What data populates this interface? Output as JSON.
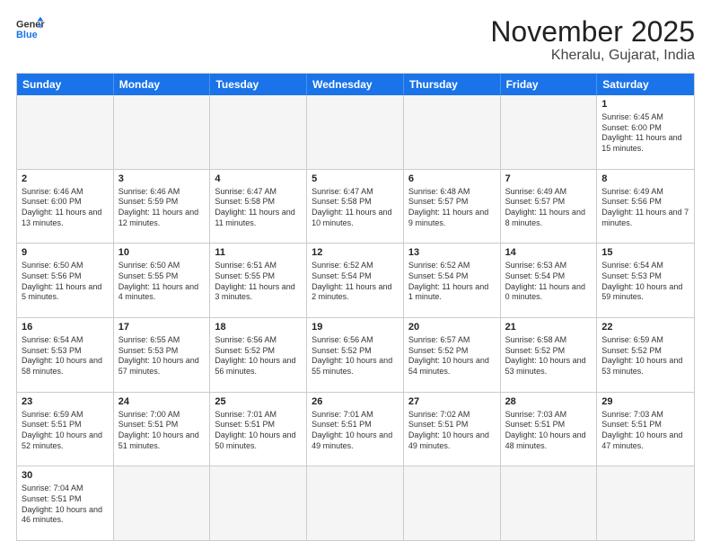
{
  "header": {
    "logo_general": "General",
    "logo_blue": "Blue",
    "title": "November 2025",
    "subtitle": "Kheralu, Gujarat, India"
  },
  "days_of_week": [
    "Sunday",
    "Monday",
    "Tuesday",
    "Wednesday",
    "Thursday",
    "Friday",
    "Saturday"
  ],
  "weeks": [
    [
      {
        "day": "",
        "info": ""
      },
      {
        "day": "",
        "info": ""
      },
      {
        "day": "",
        "info": ""
      },
      {
        "day": "",
        "info": ""
      },
      {
        "day": "",
        "info": ""
      },
      {
        "day": "",
        "info": ""
      },
      {
        "day": "1",
        "info": "Sunrise: 6:45 AM\nSunset: 6:00 PM\nDaylight: 11 hours\nand 15 minutes."
      }
    ],
    [
      {
        "day": "2",
        "info": "Sunrise: 6:46 AM\nSunset: 6:00 PM\nDaylight: 11 hours\nand 13 minutes."
      },
      {
        "day": "3",
        "info": "Sunrise: 6:46 AM\nSunset: 5:59 PM\nDaylight: 11 hours\nand 12 minutes."
      },
      {
        "day": "4",
        "info": "Sunrise: 6:47 AM\nSunset: 5:58 PM\nDaylight: 11 hours\nand 11 minutes."
      },
      {
        "day": "5",
        "info": "Sunrise: 6:47 AM\nSunset: 5:58 PM\nDaylight: 11 hours\nand 10 minutes."
      },
      {
        "day": "6",
        "info": "Sunrise: 6:48 AM\nSunset: 5:57 PM\nDaylight: 11 hours\nand 9 minutes."
      },
      {
        "day": "7",
        "info": "Sunrise: 6:49 AM\nSunset: 5:57 PM\nDaylight: 11 hours\nand 8 minutes."
      },
      {
        "day": "8",
        "info": "Sunrise: 6:49 AM\nSunset: 5:56 PM\nDaylight: 11 hours\nand 7 minutes."
      }
    ],
    [
      {
        "day": "9",
        "info": "Sunrise: 6:50 AM\nSunset: 5:56 PM\nDaylight: 11 hours\nand 5 minutes."
      },
      {
        "day": "10",
        "info": "Sunrise: 6:50 AM\nSunset: 5:55 PM\nDaylight: 11 hours\nand 4 minutes."
      },
      {
        "day": "11",
        "info": "Sunrise: 6:51 AM\nSunset: 5:55 PM\nDaylight: 11 hours\nand 3 minutes."
      },
      {
        "day": "12",
        "info": "Sunrise: 6:52 AM\nSunset: 5:54 PM\nDaylight: 11 hours\nand 2 minutes."
      },
      {
        "day": "13",
        "info": "Sunrise: 6:52 AM\nSunset: 5:54 PM\nDaylight: 11 hours\nand 1 minute."
      },
      {
        "day": "14",
        "info": "Sunrise: 6:53 AM\nSunset: 5:54 PM\nDaylight: 11 hours\nand 0 minutes."
      },
      {
        "day": "15",
        "info": "Sunrise: 6:54 AM\nSunset: 5:53 PM\nDaylight: 10 hours\nand 59 minutes."
      }
    ],
    [
      {
        "day": "16",
        "info": "Sunrise: 6:54 AM\nSunset: 5:53 PM\nDaylight: 10 hours\nand 58 minutes."
      },
      {
        "day": "17",
        "info": "Sunrise: 6:55 AM\nSunset: 5:53 PM\nDaylight: 10 hours\nand 57 minutes."
      },
      {
        "day": "18",
        "info": "Sunrise: 6:56 AM\nSunset: 5:52 PM\nDaylight: 10 hours\nand 56 minutes."
      },
      {
        "day": "19",
        "info": "Sunrise: 6:56 AM\nSunset: 5:52 PM\nDaylight: 10 hours\nand 55 minutes."
      },
      {
        "day": "20",
        "info": "Sunrise: 6:57 AM\nSunset: 5:52 PM\nDaylight: 10 hours\nand 54 minutes."
      },
      {
        "day": "21",
        "info": "Sunrise: 6:58 AM\nSunset: 5:52 PM\nDaylight: 10 hours\nand 53 minutes."
      },
      {
        "day": "22",
        "info": "Sunrise: 6:59 AM\nSunset: 5:52 PM\nDaylight: 10 hours\nand 53 minutes."
      }
    ],
    [
      {
        "day": "23",
        "info": "Sunrise: 6:59 AM\nSunset: 5:51 PM\nDaylight: 10 hours\nand 52 minutes."
      },
      {
        "day": "24",
        "info": "Sunrise: 7:00 AM\nSunset: 5:51 PM\nDaylight: 10 hours\nand 51 minutes."
      },
      {
        "day": "25",
        "info": "Sunrise: 7:01 AM\nSunset: 5:51 PM\nDaylight: 10 hours\nand 50 minutes."
      },
      {
        "day": "26",
        "info": "Sunrise: 7:01 AM\nSunset: 5:51 PM\nDaylight: 10 hours\nand 49 minutes."
      },
      {
        "day": "27",
        "info": "Sunrise: 7:02 AM\nSunset: 5:51 PM\nDaylight: 10 hours\nand 49 minutes."
      },
      {
        "day": "28",
        "info": "Sunrise: 7:03 AM\nSunset: 5:51 PM\nDaylight: 10 hours\nand 48 minutes."
      },
      {
        "day": "29",
        "info": "Sunrise: 7:03 AM\nSunset: 5:51 PM\nDaylight: 10 hours\nand 47 minutes."
      }
    ],
    [
      {
        "day": "30",
        "info": "Sunrise: 7:04 AM\nSunset: 5:51 PM\nDaylight: 10 hours\nand 46 minutes."
      },
      {
        "day": "",
        "info": ""
      },
      {
        "day": "",
        "info": ""
      },
      {
        "day": "",
        "info": ""
      },
      {
        "day": "",
        "info": ""
      },
      {
        "day": "",
        "info": ""
      },
      {
        "day": "",
        "info": ""
      }
    ]
  ]
}
